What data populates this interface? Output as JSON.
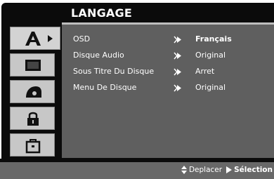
{
  "screen": {
    "title": "LANGAGE"
  },
  "sidebar": {
    "tabs": [
      {
        "name": "language",
        "icon": "language-a-icon",
        "active": true
      },
      {
        "name": "display",
        "icon": "tv-screen-icon",
        "active": false
      },
      {
        "name": "audio",
        "icon": "disc-audio-icon",
        "active": false
      },
      {
        "name": "lock",
        "icon": "padlock-icon",
        "active": false
      },
      {
        "name": "others",
        "icon": "briefcase-icon",
        "active": false
      }
    ]
  },
  "menu": {
    "items": [
      {
        "label": "OSD",
        "value": "Français",
        "selected": true
      },
      {
        "label": "Disque Audio",
        "value": "Original",
        "selected": false
      },
      {
        "label": "Sous Titre Du Disque",
        "value": "Arret",
        "selected": false
      },
      {
        "label": "Menu De Disque",
        "value": "Original",
        "selected": false
      }
    ]
  },
  "statusbar": {
    "move_label": "Deplacer",
    "select_label": "Sélection"
  },
  "colors": {
    "frame": "#0b0b0b",
    "panel": "#5f5f5f",
    "tab": "#c7c7c7",
    "text": "#ffffff"
  }
}
